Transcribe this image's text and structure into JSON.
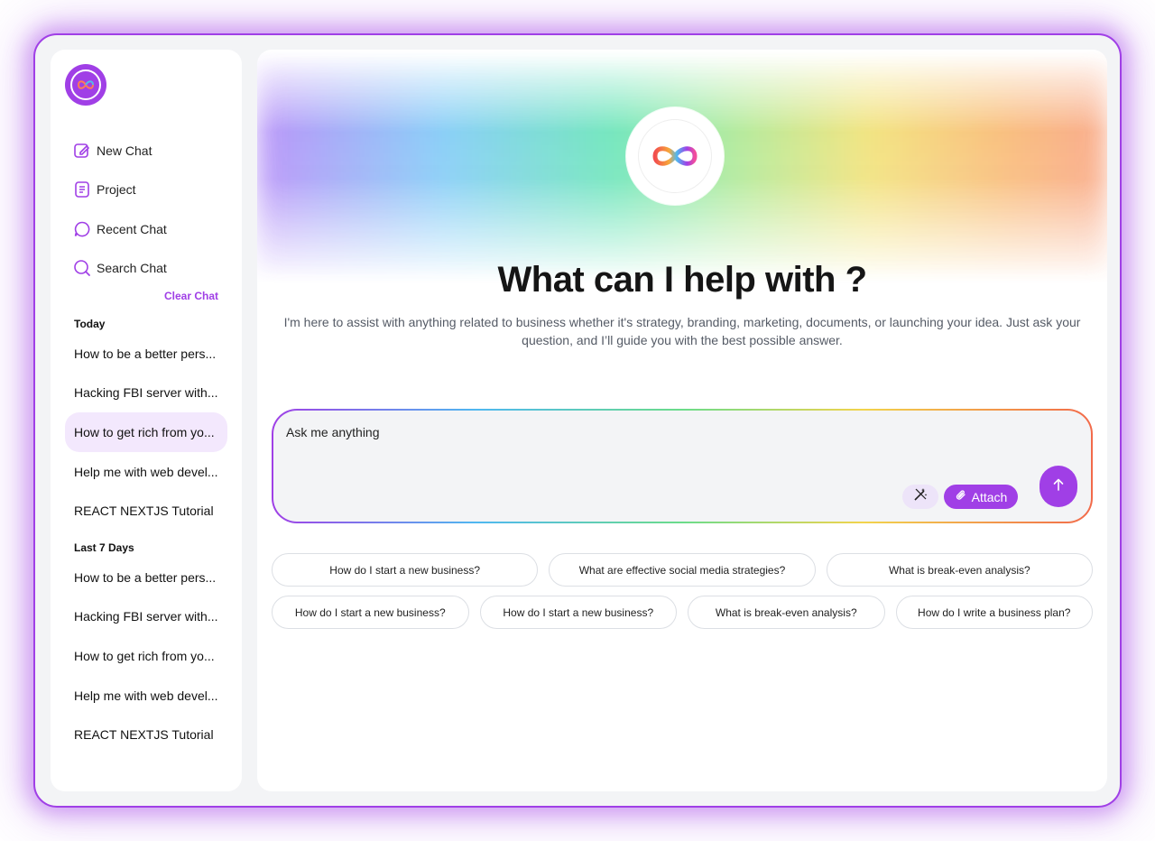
{
  "sidebar": {
    "nav": [
      {
        "label": "New Chat",
        "icon": "edit-icon"
      },
      {
        "label": "Project",
        "icon": "document-icon"
      },
      {
        "label": "Recent Chat",
        "icon": "chat-bubble-icon"
      },
      {
        "label": "Search Chat",
        "icon": "search-icon"
      }
    ],
    "clear_chat": "Clear Chat",
    "sections": [
      {
        "title": "Today",
        "items": [
          "How to be a better pers...",
          "Hacking FBI server with...",
          "How to get rich from yo...",
          "Help me with web devel...",
          "REACT NEXTJS Tutorial"
        ]
      },
      {
        "title": "Last 7 Days",
        "items": [
          "How to be a better pers...",
          "Hacking FBI server with...",
          "How to get rich from yo...",
          "Help me with web devel...",
          "REACT NEXTJS Tutorial"
        ]
      }
    ]
  },
  "main": {
    "title": "What can I help with ?",
    "subtitle": "I'm here to assist with anything related to business whether it's strategy, branding, marketing, documents, or launching your idea. Just ask your question, and I’ll guide you with the best possible answer.",
    "composer": {
      "placeholder": "Ask me anything",
      "attach_label": "Attach"
    },
    "suggestions_row1": [
      "How do I start a new business?",
      "What are effective social media strategies?",
      "What is break-even analysis?"
    ],
    "suggestions_row2": [
      "How do I start a new business?",
      "How do I start a new business?",
      "What is break-even analysis?",
      "How do I write a business plan?"
    ]
  },
  "colors": {
    "accent": "#a03fe6",
    "active_bg": "#f3e8fd"
  }
}
